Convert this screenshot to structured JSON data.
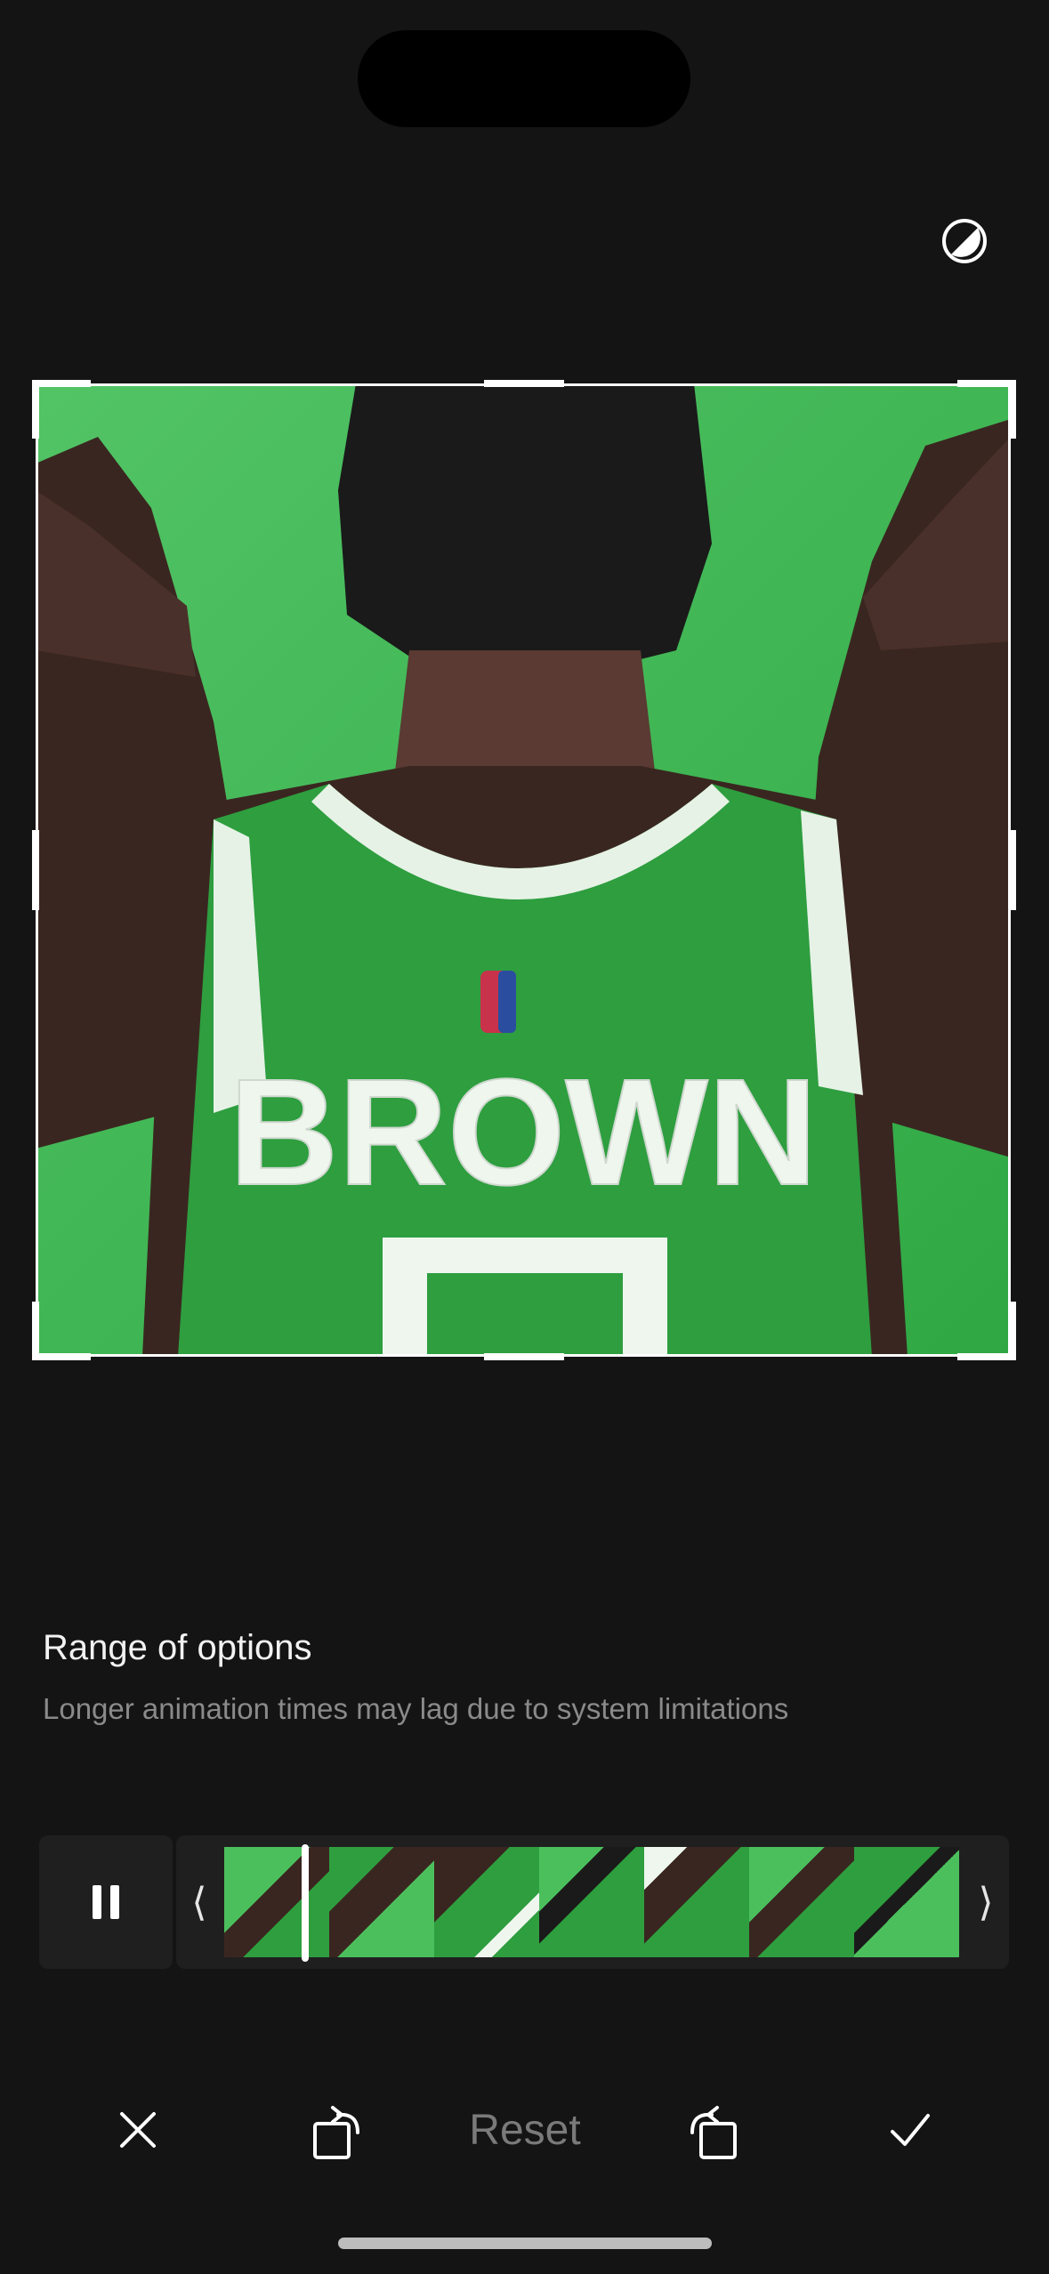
{
  "header": {
    "contrast_icon": "contrast-icon"
  },
  "preview": {
    "jersey_text": "BROWN",
    "accent_color": "#3db54e"
  },
  "info": {
    "title": "Range of options",
    "subtitle": "Longer animation times may lag due to system limitations"
  },
  "timeline": {
    "left_arrow": "⟨",
    "right_arrow": "⟩",
    "pause_icon": "pause-icon",
    "frame_count": 7
  },
  "toolbar": {
    "cancel_icon": "close-icon",
    "rotate_left_icon": "rotate-left-icon",
    "reset_label": "Reset",
    "rotate_right_icon": "rotate-right-icon",
    "confirm_icon": "checkmark-icon"
  }
}
